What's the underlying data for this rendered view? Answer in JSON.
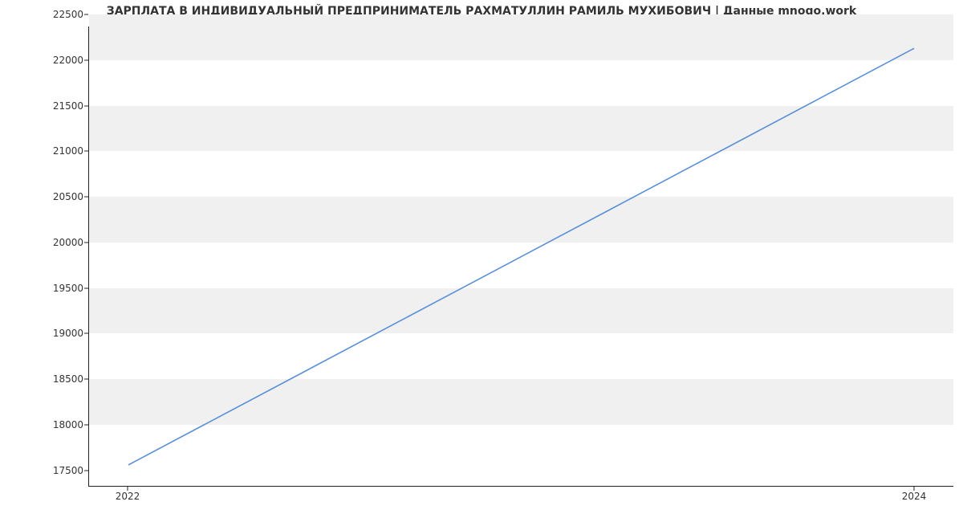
{
  "chart_data": {
    "type": "line",
    "title": "ЗАРПЛАТА В ИНДИВИДУАЛЬНЫЙ ПРЕДПРИНИМАТЕЛЬ РАХМАТУЛЛИН РАМИЛЬ МУХИБОВИЧ | Данные mnogo.work",
    "xlabel": "",
    "ylabel": "",
    "x": [
      2022,
      2024
    ],
    "values": [
      17550,
      22130
    ],
    "x_ticks": [
      2022,
      2024
    ],
    "y_ticks": [
      17500,
      18000,
      18500,
      19000,
      19500,
      20000,
      20500,
      21000,
      21500,
      22000,
      22500
    ],
    "xlim": [
      2021.9,
      2024.1
    ],
    "ylim": [
      17320,
      22370
    ],
    "line_color": "#5a8fd6",
    "band_color": "#f0f0f0"
  }
}
